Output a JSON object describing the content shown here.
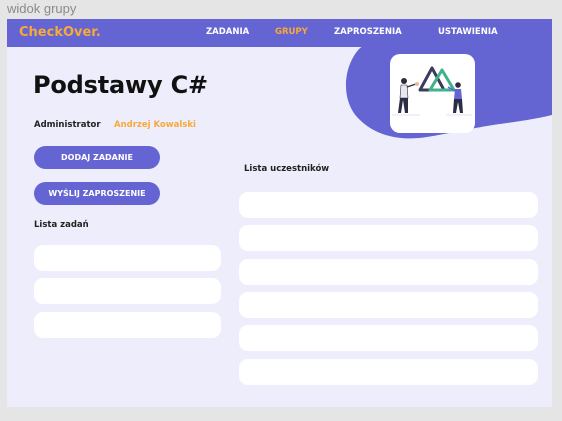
{
  "window": {
    "title": "widok grupy"
  },
  "nav": {
    "logo": "CheckOver.",
    "links": [
      "ZADANIA",
      "GRUPY",
      "ZAPROSZENIA",
      "USTAWIENIA"
    ],
    "active": "GRUPY"
  },
  "group": {
    "title": "Podstawy C#",
    "role_label": "Administrator",
    "role_value": "Andrzej Kowalski"
  },
  "actions": {
    "add_task": "DODAJ ZADANIE",
    "send_invite": "WYŚLIJ ZAPROSZENIE"
  },
  "tasks": {
    "title": "Lista zadań"
  },
  "students": {
    "title": "Lista uczestników"
  },
  "colors": {
    "brand": "#6465d2",
    "accent": "#f7a93a",
    "background": "#eeedfb"
  }
}
